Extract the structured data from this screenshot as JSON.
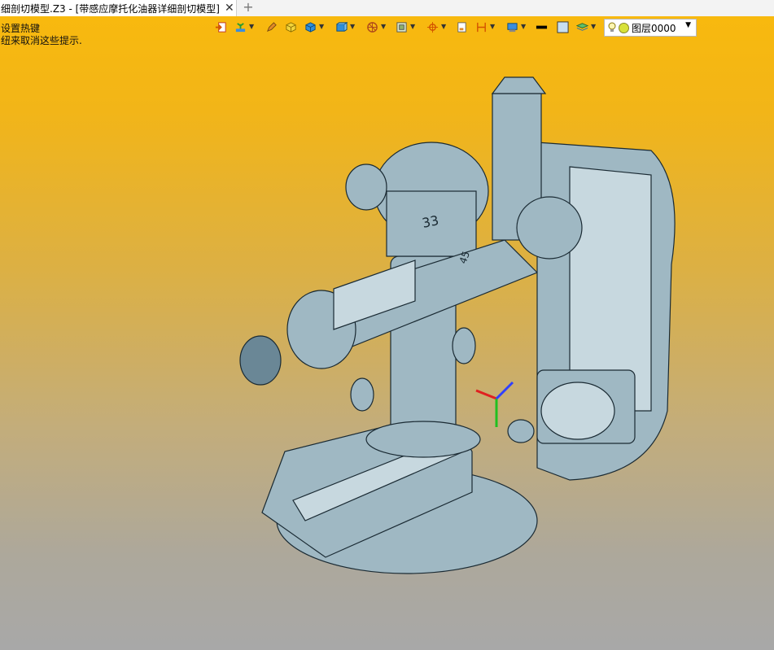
{
  "tab": {
    "title": "细剖切模型.Z3 - [带感应摩托化油器详细剖切模型]",
    "close_glyph": "✕",
    "add_glyph": "+"
  },
  "hints": {
    "line1": "设置热键",
    "line2": "纽来取消这些提示."
  },
  "toolbar": {
    "icons": [
      "exit-icon",
      "plant-icon",
      "pen-icon",
      "yellow-cube-icon",
      "blue-cube-icon",
      "view-cube-icon",
      "sphere-view-icon",
      "frame-icon",
      "target-icon",
      "sheet-icon",
      "dimension-icon",
      "render-icon",
      "line-color-icon",
      "fill-color-icon",
      "layer-stack-icon"
    ],
    "layer_select": {
      "value": "图层0000"
    }
  },
  "model": {
    "labels": [
      "33",
      "45"
    ]
  },
  "colors": {
    "gradient_top": "#f8b90e",
    "gradient_bottom": "#a8a8a8",
    "part_fill": "#9fb8c3",
    "part_stroke": "#1a2a33"
  }
}
